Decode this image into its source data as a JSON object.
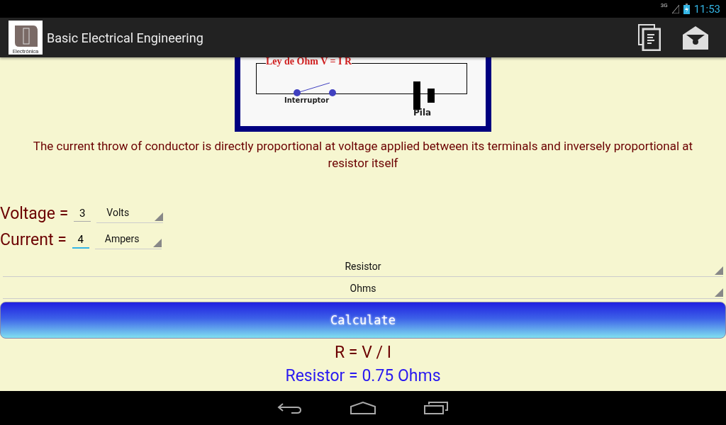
{
  "status_bar": {
    "network": "3G",
    "time": "11:53"
  },
  "action_bar": {
    "title": "Basic Electrical Engineering",
    "logo_label": "Electrónica"
  },
  "diagram": {
    "formula": "Ley de Ohm   V = I R",
    "switch_label": "Interruptor",
    "battery_label": "Pila"
  },
  "description": "The current throw of conductor is directly proportional at voltage applied between its terminals and inversely proportional at resistor itself",
  "inputs": [
    {
      "label": "Voltage =",
      "value": "3",
      "unit": "Volts",
      "focused": false
    },
    {
      "label": "Current =",
      "value": "4",
      "unit": "Ampers",
      "focused": true
    }
  ],
  "selectors": [
    "Resistor",
    "Ohms"
  ],
  "button": "Calculate",
  "formula": "R = V / I",
  "result": "Resistor = 0.75 Ohms"
}
